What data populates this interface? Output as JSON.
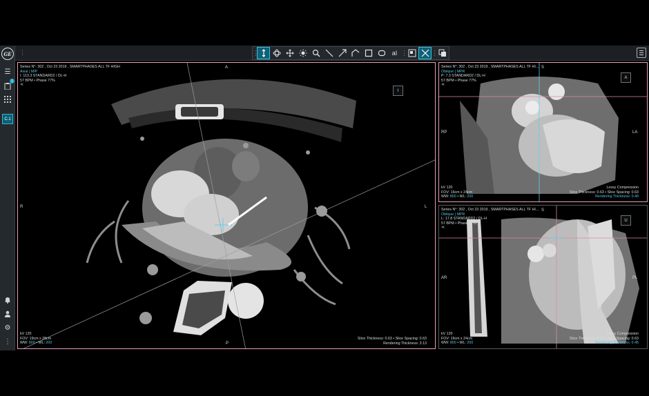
{
  "rail": {
    "logo": "GE",
    "badge_count": "1",
    "active_item": "C.1"
  },
  "toolbar": {
    "tools": [
      "scroll-tool",
      "rotate-3d-tool",
      "pan-tool",
      "window-level-tool",
      "zoom-tool",
      "line-measure-tool",
      "arrow-annotation-tool",
      "angle-tool",
      "rectangle-roi-tool",
      "ellipse-roi-tool",
      "text-annotation-tool"
    ],
    "text_tool_label": "aI",
    "active_tool": "scroll-tool"
  },
  "main_viewport": {
    "line1": "Series N°: 302 , Oct 23 2019 , SMARTPHASES ALL TF HIGH",
    "line2": "Axial | MIP",
    "line3": "I: 113.3 STANDARD2 / DL-H",
    "line4": "57 BPM • Phase 77%",
    "orient_top": "A",
    "orient_left": "R",
    "orient_right": "L",
    "orient_bottom": "P",
    "corner_button": "I",
    "kv": "kV 120",
    "fov": "FOV: 19cm x 28cm",
    "ww_label": "WW:",
    "ww_value": "800",
    "wl_label": "• WL:",
    "wl_value": "200",
    "slice": "Slice Thickness: 0.63 • Slice Spacing: 0.63",
    "rendering": "Rendering Thickness: 3.13"
  },
  "top_right_viewport": {
    "line1": "Series N°: 302 , Oct 23 2019 , SMARTPHASES ALL TF HI...",
    "line2": "Oblique | MPR",
    "line3": "P: 7.3 STANDARD2 / DL-H",
    "line4": "57 BPM • Phase 77%",
    "orient_top": "S",
    "orient_left": "RP",
    "orient_right": "LA",
    "corner_button": "A",
    "kv": "kV 120",
    "fov": "FOV: 16cm x 24cm",
    "ww_label": "WW:",
    "ww_value": "800",
    "wl_label": "• WL:",
    "wl_value": "200",
    "compression": "Lossy Compression",
    "slice": "Slice Thickness: 0.63 • Slice Spacing: 0.63",
    "rendering": "Rendering Thickness: 0.49"
  },
  "bottom_right_viewport": {
    "line1": "Series N°: 302 , Oct 23 2019 , SMARTPHASES ALL TF HI...",
    "line2": "Oblique | MPR",
    "line3": "L: 17.8 STANDARD2 / DL-H",
    "line4": "57 BPM • Phase 77%",
    "orient_top": "S",
    "orient_left": "AR",
    "orient_right": "PL",
    "corner_button": "U",
    "kv": "kV 120",
    "fov": "FOV: 16cm x 24cm",
    "ww_label": "WW:",
    "ww_value": "800",
    "wl_label": "• WL:",
    "wl_value": "200",
    "compression": "Lossy Compression",
    "slice": "Slice Thickness: 0.63 • Slice Spacing: 0.63",
    "rendering": "Rendering Thickness: 0.45"
  },
  "colors": {
    "accent": "#2fb8d6",
    "selected_border": "#e8a0b8",
    "crosshair_pink": "#d98aa8",
    "crosshair_blue": "#5fd0ea"
  }
}
